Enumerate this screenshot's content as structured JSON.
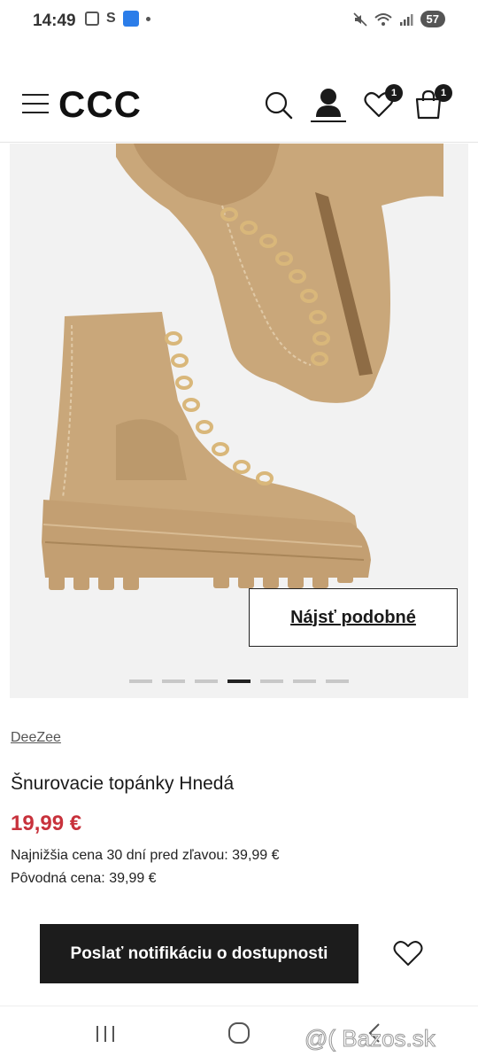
{
  "status_bar": {
    "time": "14:49",
    "s_label": "S",
    "battery": "57",
    "icons": [
      "screenshot-icon",
      "s-app-icon",
      "blue-app-icon",
      "dot-icon",
      "mute-icon",
      "wifi-icon",
      "signal-icon",
      "battery-icon"
    ]
  },
  "header": {
    "logo": "CCC",
    "wishlist_count": "1",
    "cart_count": "1",
    "icons": [
      "hamburger-menu-icon",
      "search-icon",
      "user-icon",
      "heart-icon",
      "shopping-bag-icon"
    ]
  },
  "gallery": {
    "find_similar_label": "Nájsť podobné",
    "page_count": 7,
    "active_index": 3
  },
  "product": {
    "brand": "DeeZee",
    "title": "Šnurovacie topánky Hnedá",
    "price": "19,99 €",
    "lowest_price_line": "Najnižšia cena 30 dní pred zľavou: 39,99 €",
    "original_price_line": "Pôvodná cena: 39,99 €"
  },
  "actions": {
    "notify_label": "Poslať notifikáciu o dostupnosti"
  },
  "colors": {
    "price_red": "#c8323c",
    "button_dark": "#1c1c1c",
    "boot_tan": "#c9a77a"
  },
  "watermark": "@( Bazos.sk"
}
